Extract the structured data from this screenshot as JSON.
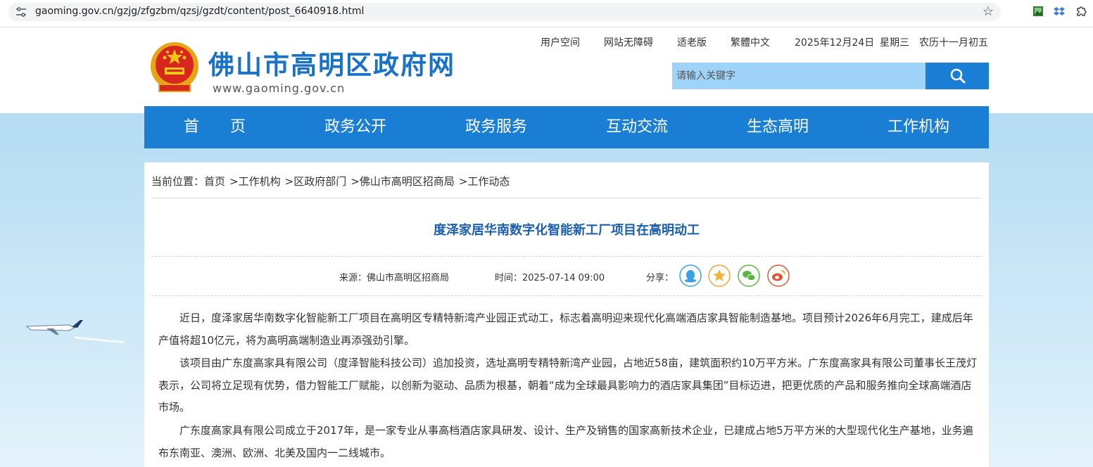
{
  "browser": {
    "url": "gaoming.gov.cn/gzjg/zfgzbm/qzsj/gzdt/content/post_6640918.html"
  },
  "header": {
    "site_title": "佛山市高明区政府网",
    "site_url": "www.gaoming.gov.cn",
    "links": [
      "用户空间",
      "网站无障碍",
      "适老版",
      "繁體中文"
    ],
    "date": "2025年12月24日",
    "weekday": "星期三",
    "lunar": "农历十一月初五",
    "search_placeholder": "请输入关键字"
  },
  "nav": [
    "首　　页",
    "政务公开",
    "政务服务",
    "互动交流",
    "生态高明",
    "工作机构"
  ],
  "breadcrumb": {
    "prefix": "当前位置：",
    "items": [
      "首页",
      "工作机构",
      "区政府部门",
      "佛山市高明区招商局",
      "工作动态"
    ],
    "separator": ">"
  },
  "article": {
    "title": "度泽家居华南数字化智能新工厂项目在高明动工",
    "source": "来源：佛山市高明区招商局",
    "time": "时间：2025-07-14 09:00",
    "share_label": "分享：",
    "share_icons": [
      "qq-icon",
      "qzone-icon",
      "wechat-icon",
      "weibo-icon"
    ],
    "paragraphs": [
      "近日，度泽家居华南数字化智能新工厂项目在高明区专精特新湾产业园正式动工，标志着高明迎来现代化高端酒店家具智能制造基地。项目预计2026年6月完工，建成后年产值将超10亿元，将为高明高端制造业再添强劲引擎。",
      "该项目由广东度高家具有限公司（度泽智能科技公司）追加投资，选址高明专精特新湾产业园，占地近58亩，建筑面积约10万平方米。广东度高家具有限公司董事长王茂灯表示，公司将立足现有优势，借力智能工厂赋能，以创新为驱动、品质为根基，朝着“成为全球最具影响力的酒店家具集团”目标迈进，把更优质的产品和服务推向全球高端酒店市场。",
      "广东度高家具有限公司成立于2017年，是一家专业从事高档酒店家具研发、设计、生产及销售的国家高新技术企业，已建成占地5万平方米的大型现代化生产基地，业务遍布东南亚、澳洲、欧洲、北美及国内一二线城市。"
    ]
  },
  "colors": {
    "brand_blue": "#1a7fd4",
    "title_blue": "#1a5fae",
    "search_bg": "#9fd3f7"
  }
}
